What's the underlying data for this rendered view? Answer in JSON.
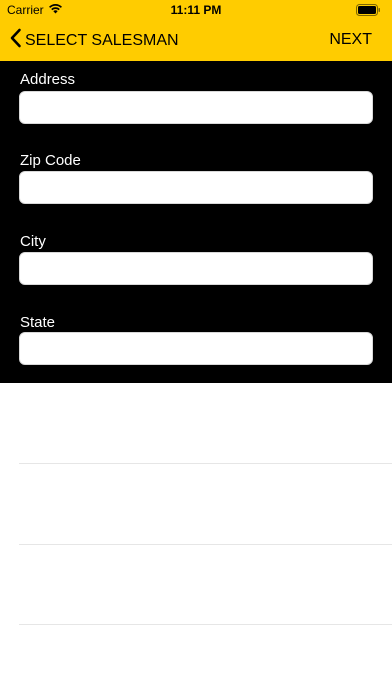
{
  "status_bar": {
    "carrier": "Carrier",
    "time": "11:11 PM"
  },
  "nav": {
    "back_label": "SELECT SALESMAN",
    "next_label": "NEXT"
  },
  "form": {
    "address": {
      "label": "Address",
      "value": ""
    },
    "zip": {
      "label": "Zip Code",
      "value": ""
    },
    "city": {
      "label": "City",
      "value": ""
    },
    "state": {
      "label": "State",
      "value": ""
    }
  },
  "colors": {
    "header": "#ffcc00",
    "form_background": "#000000"
  }
}
